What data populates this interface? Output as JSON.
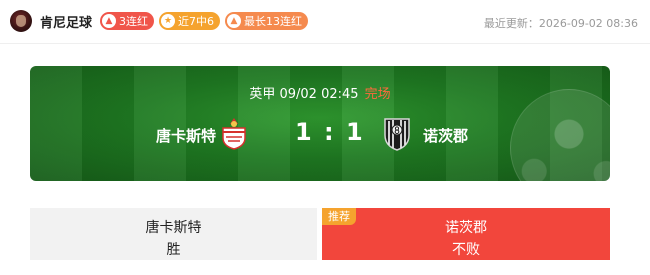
{
  "header": {
    "author": "肯尼足球",
    "badges": [
      {
        "icon": "flame-icon",
        "text": "3连红",
        "color": "#f0554a"
      },
      {
        "icon": "star-icon",
        "text": "近7中6",
        "color": "#f5a32e"
      },
      {
        "icon": "thumb-icon",
        "text": "最长13连红",
        "color": "#f58a4e"
      }
    ],
    "update_label": "最近更新：",
    "update_time": "2026-09-02 08:36"
  },
  "match": {
    "league": "英甲",
    "datetime": "09/02 02:45",
    "status": "完场",
    "home_team": "唐卡斯特",
    "away_team": "诺茨郡",
    "score": "1 : 1"
  },
  "options": {
    "home": {
      "team": "唐卡斯特",
      "result": "胜"
    },
    "away": {
      "team": "诺茨郡",
      "result": "不败",
      "tag": "推荐"
    }
  },
  "colors": {
    "accent_red": "#f2463c",
    "tag_orange": "#f5a32e",
    "status_orange": "#ff6a3c",
    "pitch_green": "#1f7a22"
  }
}
